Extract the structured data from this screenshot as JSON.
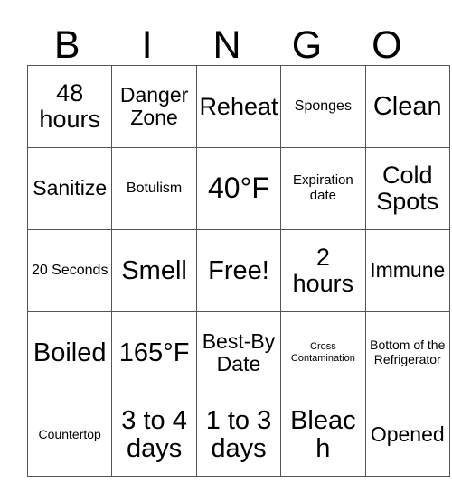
{
  "card": {
    "header_letters": [
      "B",
      "I",
      "N",
      "G",
      "O"
    ],
    "columns": 5,
    "rows": 5,
    "free_space_label": "Free!",
    "free_space_position": {
      "row": 3,
      "column": 3
    },
    "border_color": "#555555",
    "text_color": "#000000",
    "background_color": "#ffffff",
    "cells": [
      [
        {
          "text": "48 hours",
          "size": "xl"
        },
        {
          "text": "Danger Zone",
          "size": "lg"
        },
        {
          "text": "Reheat",
          "size": "xl"
        },
        {
          "text": "Sponges",
          "size": "md"
        },
        {
          "text": "Clean",
          "size": "xxl"
        }
      ],
      [
        {
          "text": "Sanitize",
          "size": "lg"
        },
        {
          "text": "Botulism",
          "size": "md"
        },
        {
          "text": "40°F",
          "size": "max"
        },
        {
          "text": "Expiration date",
          "size": "smp"
        },
        {
          "text": "Cold Spots",
          "size": "xl"
        }
      ],
      [
        {
          "text": "20 Seconds",
          "size": "md"
        },
        {
          "text": "Smell",
          "size": "xxl"
        },
        {
          "text": "Free!",
          "size": "xxl"
        },
        {
          "text": "2 hours",
          "size": "xl"
        },
        {
          "text": "Immune",
          "size": "lg"
        }
      ],
      [
        {
          "text": "Boiled",
          "size": "xxl"
        },
        {
          "text": "165°F",
          "size": "xxl"
        },
        {
          "text": "Best-By Date",
          "size": "lg"
        },
        {
          "text": "Cross Contamination",
          "size": "xs"
        },
        {
          "text": "Bottom of the Refrigerator",
          "size": "sm"
        }
      ],
      [
        {
          "text": "Countertop",
          "size": "sm"
        },
        {
          "text": "3 to 4 days",
          "size": "xxl"
        },
        {
          "text": "1 to 3 days",
          "size": "xxl"
        },
        {
          "text": "Bleach",
          "size": "xxl"
        },
        {
          "text": "Opened",
          "size": "lg"
        }
      ]
    ]
  }
}
